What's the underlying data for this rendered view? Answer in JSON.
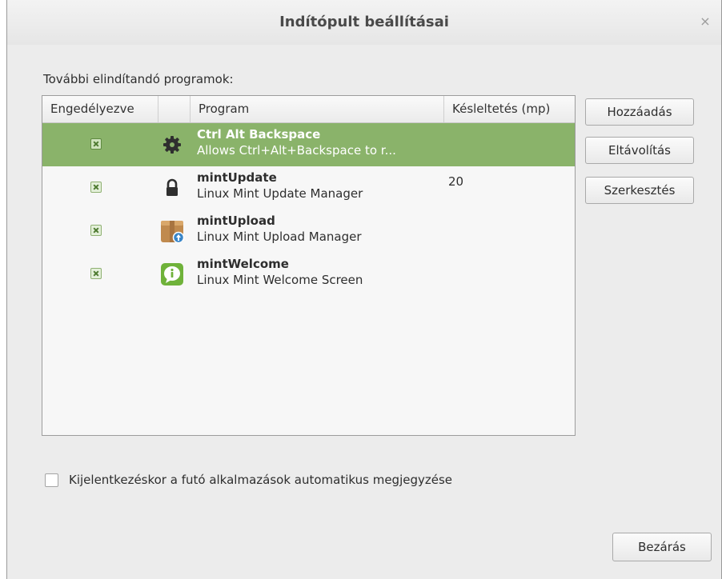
{
  "window": {
    "title": "Indítópult beállításai",
    "close_glyph": "×"
  },
  "section_label": "További elindítandó programok:",
  "table": {
    "columns": [
      "Engedélyezve",
      "",
      "Program",
      "Késleltetés (mp)"
    ],
    "rows": [
      {
        "enabled": true,
        "icon": "gear-icon",
        "name": "Ctrl Alt Backspace",
        "description": "Allows Ctrl+Alt+Backspace to r...",
        "delay": "",
        "selected": true
      },
      {
        "enabled": true,
        "icon": "lock-icon",
        "name": "mintUpdate",
        "description": "Linux Mint Update Manager",
        "delay": "20",
        "selected": false
      },
      {
        "enabled": true,
        "icon": "upload-package-icon",
        "name": "mintUpload",
        "description": "Linux Mint Upload Manager",
        "delay": "",
        "selected": false
      },
      {
        "enabled": true,
        "icon": "info-chat-icon",
        "name": "mintWelcome",
        "description": "Linux Mint Welcome Screen",
        "delay": "",
        "selected": false
      }
    ]
  },
  "buttons": {
    "add": "Hozzáadás",
    "remove": "Eltávolítás",
    "edit": "Szerkesztés",
    "close": "Bezárás"
  },
  "autosave": {
    "label": "Kijelentkezéskor a futó alkalmazások automatikus megjegyzése",
    "checked": false
  },
  "colors": {
    "selection": "#8ab36a",
    "accent_green": "#6fb23a"
  }
}
